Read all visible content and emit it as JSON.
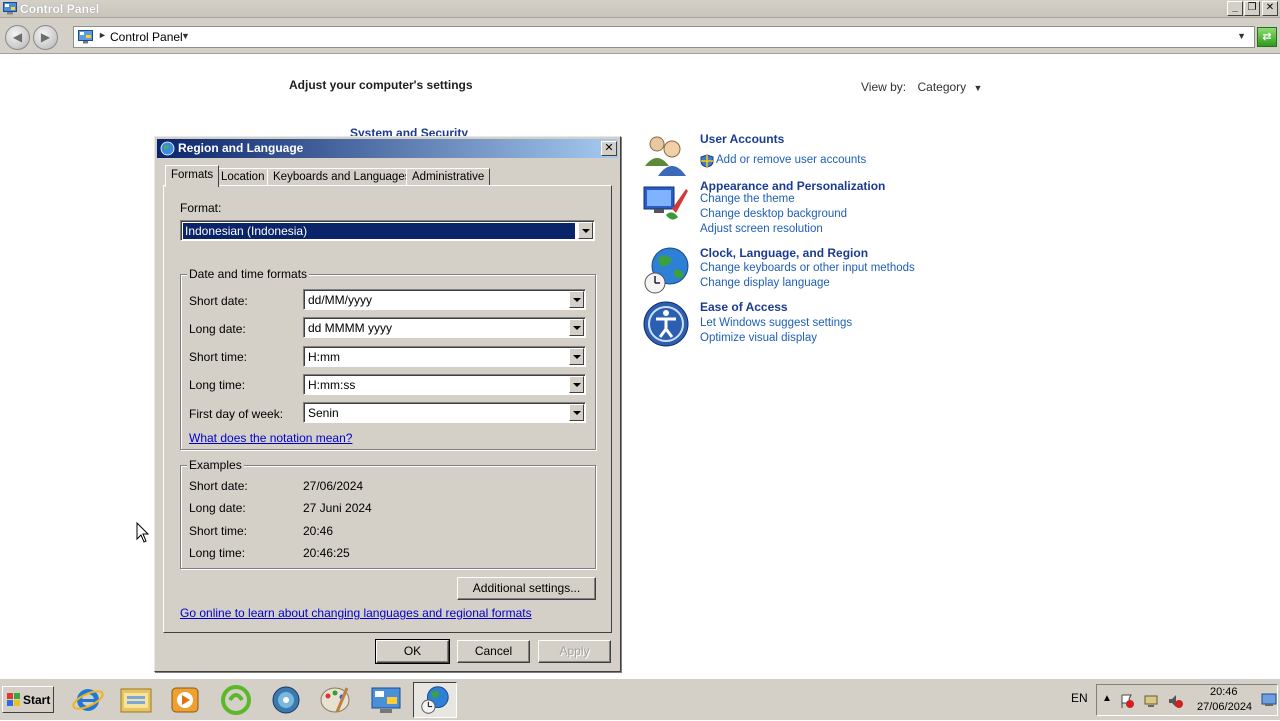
{
  "window": {
    "title": "Control Panel",
    "controls": [
      "_",
      "❐",
      "✕"
    ]
  },
  "address": {
    "breadcrumb": "Control Panel"
  },
  "control_panel": {
    "heading": "Adjust your computer's settings",
    "view_by_label": "View by:",
    "view_by_value": "Category",
    "peek_category": "System and Security",
    "categories": [
      {
        "icon": "user-accounts-icon",
        "title": "User Accounts",
        "links": [
          "Add or remove user accounts"
        ]
      },
      {
        "icon": "appearance-icon",
        "title": "Appearance and Personalization",
        "links": [
          "Change the theme",
          "Change desktop background",
          "Adjust screen resolution"
        ]
      },
      {
        "icon": "clock-globe-icon",
        "title": "Clock, Language, and Region",
        "links": [
          "Change keyboards or other input methods",
          "Change display language"
        ]
      },
      {
        "icon": "ease-of-access-icon",
        "title": "Ease of Access",
        "links": [
          "Let Windows suggest settings",
          "Optimize visual display"
        ]
      }
    ]
  },
  "dialog": {
    "title": "Region and Language",
    "close": "✕",
    "tabs": [
      "Formats",
      "Location",
      "Keyboards and Languages",
      "Administrative"
    ],
    "format_label": "Format:",
    "format_value": "Indonesian (Indonesia)",
    "datetime_group": "Date and time formats",
    "fields": [
      {
        "label": "Short date:",
        "value": "dd/MM/yyyy"
      },
      {
        "label": "Long date:",
        "value": "dd MMMM yyyy"
      },
      {
        "label": "Short time:",
        "value": "H:mm"
      },
      {
        "label": "Long time:",
        "value": "H:mm:ss"
      },
      {
        "label": "First day of week:",
        "value": "Senin"
      }
    ],
    "notation_link": "What does the notation mean?",
    "examples_group": "Examples",
    "examples": [
      {
        "label": "Short date:",
        "value": "27/06/2024"
      },
      {
        "label": "Long date:",
        "value": "27 Juni 2024"
      },
      {
        "label": "Short time:",
        "value": "20:46"
      },
      {
        "label": "Long time:",
        "value": "20:46:25"
      }
    ],
    "additional_settings": "Additional settings...",
    "online_link": "Go online to learn about changing languages and regional formats",
    "ok": "OK",
    "cancel": "Cancel",
    "apply": "Apply"
  },
  "taskbar": {
    "start": "Start",
    "language": "EN",
    "time": "20:46",
    "date": "27/06/2024"
  }
}
